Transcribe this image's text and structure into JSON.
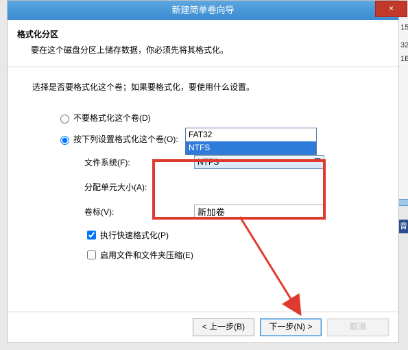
{
  "titlebar": {
    "title": "新建简单卷向导",
    "close": "×"
  },
  "header": {
    "title": "格式化分区",
    "subtitle": "要在这个磁盘分区上储存数据，你必须先将其格式化。"
  },
  "content": {
    "instruction": "选择是否要格式化这个卷；如果要格式化，要使用什么设置。",
    "radio_no_format": "不要格式化这个卷(D)",
    "radio_format": "按下列设置格式化这个卷(O):",
    "filesystem_label": "文件系统(F):",
    "alloc_label": "分配单元大小(A):",
    "volume_label": "卷标(V):",
    "volume_value": "新加卷",
    "quick_format": "执行快速格式化(P)",
    "enable_compress": "启用文件和文件夹压缩(E)",
    "combo_selected": "NTFS",
    "dropdown": {
      "opt1": "FAT32",
      "opt2": "NTFS"
    }
  },
  "footer": {
    "back": "< 上一步(B)",
    "next": "下一步(N) >",
    "cancel": "取消"
  },
  "side": {
    "n15": "15",
    "n32": "32",
    "n1b": "1B",
    "label": "音"
  },
  "icons": {
    "close": "close-icon",
    "caret": "chevron-down-icon"
  }
}
